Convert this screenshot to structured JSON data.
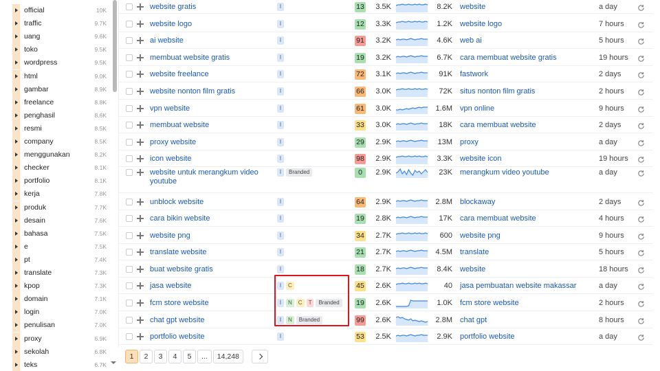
{
  "sidebar": {
    "items": [
      {
        "label": "official",
        "count": "10K"
      },
      {
        "label": "traffic",
        "count": "9.7K"
      },
      {
        "label": "uang",
        "count": "9.6K"
      },
      {
        "label": "toko",
        "count": "9.5K"
      },
      {
        "label": "wordpress",
        "count": "9.5K"
      },
      {
        "label": "html",
        "count": "9.0K"
      },
      {
        "label": "gambar",
        "count": "8.9K"
      },
      {
        "label": "freelance",
        "count": "8.8K"
      },
      {
        "label": "penghasil",
        "count": "8.6K"
      },
      {
        "label": "resmi",
        "count": "8.5K"
      },
      {
        "label": "company",
        "count": "8.5K"
      },
      {
        "label": "menggunakan",
        "count": "8.2K"
      },
      {
        "label": "checker",
        "count": "8.1K"
      },
      {
        "label": "portfolio",
        "count": "8.1K"
      },
      {
        "label": "kerja",
        "count": "7.8K"
      },
      {
        "label": "produk",
        "count": "7.7K"
      },
      {
        "label": "desain",
        "count": "7.6K"
      },
      {
        "label": "bahasa",
        "count": "7.5K"
      },
      {
        "label": "e",
        "count": "7.5K"
      },
      {
        "label": "pt",
        "count": "7.4K"
      },
      {
        "label": "translate",
        "count": "7.3K"
      },
      {
        "label": "kpop",
        "count": "7.3K"
      },
      {
        "label": "domain",
        "count": "7.1K"
      },
      {
        "label": "login",
        "count": "7.0K"
      },
      {
        "label": "penulisan",
        "count": "7.0K"
      },
      {
        "label": "proxy",
        "count": "6.9K"
      },
      {
        "label": "sekolah",
        "count": "6.8K"
      },
      {
        "label": "teks",
        "count": "6.7K"
      }
    ]
  },
  "colors": {
    "kd_green": "#a8dfb0",
    "kd_yellow": "#fbe08a",
    "kd_orange": "#f8b878",
    "kd_red": "#f59a95",
    "link": "#1a59b5",
    "highlight": "#e0131f",
    "page_active": "#fde0b8"
  },
  "rows": [
    {
      "keyword": "website gratis",
      "intents": [
        "I"
      ],
      "branded": "",
      "kd": "13",
      "kd_level": "green",
      "volume": "3.5K",
      "trend": "flat-high",
      "cpc": "8.2K",
      "serp": "website",
      "updated": "a day"
    },
    {
      "keyword": "website logo",
      "intents": [
        "I"
      ],
      "branded": "",
      "kd": "12",
      "kd_level": "green",
      "volume": "3.3K",
      "trend": "flat-high",
      "cpc": "1.2K",
      "serp": "website logo",
      "updated": "7 hours"
    },
    {
      "keyword": "ai website",
      "intents": [
        "I"
      ],
      "branded": "",
      "kd": "91",
      "kd_level": "red",
      "volume": "3.2K",
      "trend": "flat-mid",
      "cpc": "4.6K",
      "serp": "web ai",
      "updated": "5 hours"
    },
    {
      "keyword": "membuat website gratis",
      "intents": [
        "I"
      ],
      "branded": "",
      "kd": "19",
      "kd_level": "green",
      "volume": "3.2K",
      "trend": "flat-mid",
      "cpc": "6.7K",
      "serp": "cara membuat website gratis",
      "updated": "19 hours"
    },
    {
      "keyword": "website freelance",
      "intents": [
        "I"
      ],
      "branded": "",
      "kd": "72",
      "kd_level": "orange",
      "volume": "3.1K",
      "trend": "flat-mid",
      "cpc": "91K",
      "serp": "fastwork",
      "updated": "2 days"
    },
    {
      "keyword": "website nonton film gratis",
      "intents": [
        "I"
      ],
      "branded": "",
      "kd": "66",
      "kd_level": "orange",
      "volume": "3.0K",
      "trend": "flat-high",
      "cpc": "72K",
      "serp": "situs nonton film gratis",
      "updated": "2 hours"
    },
    {
      "keyword": "vpn website",
      "intents": [
        "I"
      ],
      "branded": "",
      "kd": "61",
      "kd_level": "orange",
      "volume": "3.0K",
      "trend": "rise",
      "cpc": "1.6M",
      "serp": "vpn online",
      "updated": "9 hours"
    },
    {
      "keyword": "membuat website",
      "intents": [
        "I"
      ],
      "branded": "",
      "kd": "33",
      "kd_level": "yellow",
      "volume": "3.0K",
      "trend": "flat-mid",
      "cpc": "18K",
      "serp": "cara membuat website",
      "updated": "2 days"
    },
    {
      "keyword": "proxy website",
      "intents": [
        "I"
      ],
      "branded": "",
      "kd": "29",
      "kd_level": "green",
      "volume": "2.9K",
      "trend": "flat-mid",
      "cpc": "13M",
      "serp": "proxy",
      "updated": "a day"
    },
    {
      "keyword": "icon website",
      "intents": [
        "I"
      ],
      "branded": "",
      "kd": "98",
      "kd_level": "red",
      "volume": "2.9K",
      "trend": "flat-high",
      "cpc": "3.3K",
      "serp": "website icon",
      "updated": "19 hours"
    },
    {
      "keyword": "website untuk merangkum video youtube",
      "intents": [
        "I"
      ],
      "branded": "Branded",
      "kd": "0",
      "kd_level": "green",
      "volume": "2.9K",
      "trend": "wave",
      "cpc": "23K",
      "serp": "merangkum video youtube",
      "updated": "a day"
    },
    {
      "keyword": "unblock website",
      "intents": [
        "I"
      ],
      "branded": "",
      "kd": "64",
      "kd_level": "orange",
      "volume": "2.9K",
      "trend": "flat-mid",
      "cpc": "2.8M",
      "serp": "blockaway",
      "updated": "2 days"
    },
    {
      "keyword": "cara bikin website",
      "intents": [
        "I"
      ],
      "branded": "",
      "kd": "19",
      "kd_level": "green",
      "volume": "2.8K",
      "trend": "flat-mid",
      "cpc": "17K",
      "serp": "cara membuat website",
      "updated": "4 hours"
    },
    {
      "keyword": "website png",
      "intents": [
        "I"
      ],
      "branded": "",
      "kd": "34",
      "kd_level": "yellow",
      "volume": "2.7K",
      "trend": "flat-high",
      "cpc": "600",
      "serp": "website png",
      "updated": "9 hours"
    },
    {
      "keyword": "translate website",
      "intents": [
        "I"
      ],
      "branded": "",
      "kd": "21",
      "kd_level": "green",
      "volume": "2.7K",
      "trend": "flat-mid",
      "cpc": "4.5M",
      "serp": "translate",
      "updated": "5 hours"
    },
    {
      "keyword": "buat website gratis",
      "intents": [
        "I"
      ],
      "branded": "",
      "kd": "18",
      "kd_level": "green",
      "volume": "2.7K",
      "trend": "flat-mid",
      "cpc": "8.4K",
      "serp": "website",
      "updated": "18 hours"
    },
    {
      "keyword": "jasa website",
      "intents": [
        "I",
        "C"
      ],
      "branded": "",
      "kd": "45",
      "kd_level": "yellow",
      "volume": "2.6K",
      "trend": "flat-high",
      "cpc": "40",
      "serp": "jasa pembuatan website makassar",
      "updated": "a day"
    },
    {
      "keyword": "fcm store website",
      "intents": [
        "I",
        "N",
        "C",
        "T"
      ],
      "branded": "Branded",
      "kd": "19",
      "kd_level": "green",
      "volume": "2.6K",
      "trend": "step",
      "cpc": "1.0K",
      "serp": "fcm store website",
      "updated": "2 hours"
    },
    {
      "keyword": "chat gpt website",
      "intents": [
        "I",
        "N"
      ],
      "branded": "Branded",
      "kd": "99",
      "kd_level": "red",
      "volume": "2.6K",
      "trend": "drop",
      "cpc": "2.8M",
      "serp": "chat gpt",
      "updated": "8 hours"
    },
    {
      "keyword": "portfolio website",
      "intents": [
        "I"
      ],
      "branded": "",
      "kd": "53",
      "kd_level": "yellow",
      "volume": "2.5K",
      "trend": "flat-mid",
      "cpc": "2.9K",
      "serp": "portfolio website",
      "updated": "a day"
    }
  ],
  "pagination": {
    "pages": [
      "1",
      "2",
      "3",
      "4",
      "5",
      "...",
      "14,248"
    ],
    "active": "1"
  }
}
